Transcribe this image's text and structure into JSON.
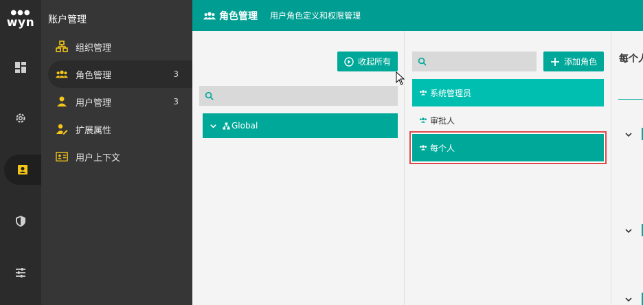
{
  "app": {
    "logo_text": "wyn"
  },
  "rail": {
    "items": [
      {
        "name": "dashboard",
        "icon": "dashboard-icon"
      },
      {
        "name": "settings",
        "icon": "gear-icon"
      },
      {
        "name": "account",
        "icon": "id-card-icon",
        "active": true
      },
      {
        "name": "security",
        "icon": "shield-icon"
      },
      {
        "name": "tuning",
        "icon": "sliders-icon"
      }
    ]
  },
  "nav": {
    "title": "账户管理",
    "items": [
      {
        "label": "组织管理",
        "icon": "org-tree-icon",
        "count": ""
      },
      {
        "label": "角色管理",
        "icon": "users-icon",
        "count": "3",
        "active": true
      },
      {
        "label": "用户管理",
        "icon": "user-icon",
        "count": "3"
      },
      {
        "label": "扩展属性",
        "icon": "user-edit-icon",
        "count": ""
      },
      {
        "label": "用户上下文",
        "icon": "contact-card-icon",
        "count": ""
      }
    ]
  },
  "header": {
    "title": "角色管理",
    "subtitle": "用户角色定义和权限管理"
  },
  "org_panel": {
    "collapse_label": "收起所有",
    "search_placeholder": "",
    "tree": [
      {
        "label": "Global",
        "expanded": true
      }
    ]
  },
  "roles_panel": {
    "search_placeholder": "",
    "add_label": "添加角色",
    "roles": [
      {
        "label": "系统管理员",
        "state": "selected"
      },
      {
        "label": "审批人",
        "state": "normal"
      },
      {
        "label": "每个人",
        "state": "highlight"
      }
    ]
  },
  "detail_panel": {
    "title": "每个人"
  },
  "colors": {
    "accent": "#009e92",
    "accent_light": "#00bfb0",
    "rail_bg": "#2b2b2b",
    "nav_bg": "#363636",
    "highlight_border": "#e0494b",
    "nav_icon": "#f5c518"
  }
}
